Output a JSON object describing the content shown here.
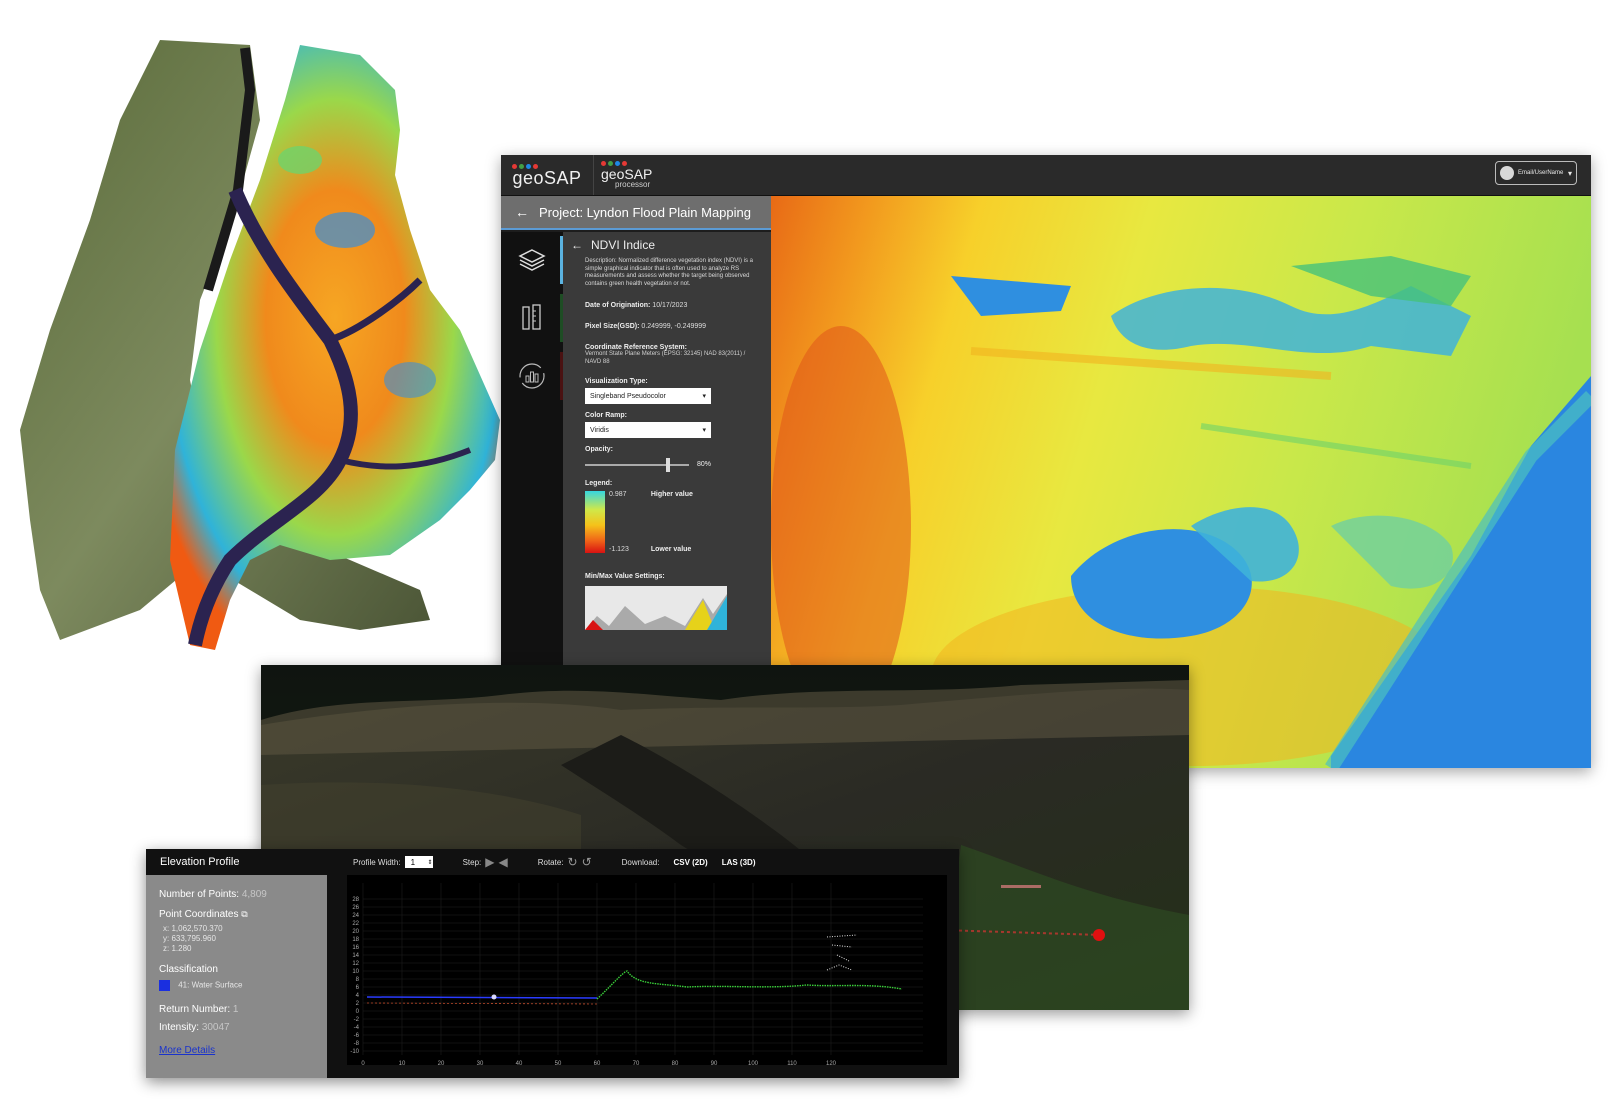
{
  "app": {
    "brand_primary": "geoSAP",
    "brand_secondary": "geoSAP",
    "brand_secondary_sub": "processor",
    "user_label": "Email/UserName",
    "project_title": "Project: Lyndon Flood Plain Mapping",
    "icons": [
      "layers-icon",
      "measure-ruler-icon",
      "analytics-refresh-icon"
    ],
    "panel": {
      "title": "NDVI Indice",
      "description": "Description: Normalized difference vegetation index (NDVI) is a simple graphical indicator that is often used to analyze RS measurements and assess whether the target being observed contains green health vegetation or not.",
      "date_label": "Date of Origination:",
      "date_value": "10/17/2023",
      "pixel_label": "Pixel Size(GSD):",
      "pixel_value": "0.249999, -0.249999",
      "crs_label": "Coordinate Reference System:",
      "crs_value": "Vermont State Plane Meters (EPSG: 32145) NAD 83(2011) / NAVD 88",
      "vis_label": "Visualization Type:",
      "vis_value": "Singleband Pseudocolor",
      "ramp_label": "Color Ramp:",
      "ramp_value": "Viridis",
      "opacity_label": "Opacity:",
      "opacity_value": "80%",
      "opacity_fraction": 0.8,
      "legend_label": "Legend:",
      "legend_max": "0.987",
      "legend_min": "-1.123",
      "legend_high": "Higher value",
      "legend_low": "Lower value",
      "minmax_label": "Min/Max Value Settings:"
    }
  },
  "elevation": {
    "title": "Elevation Profile",
    "points_label": "Number of Points:",
    "points_value": "4,809",
    "coords_label": "Point Coordinates",
    "x": "x: 1,062,570.370",
    "y": "y: 633,795.960",
    "z": "z: 1.280",
    "class_label": "Classification",
    "class_value": "41: Water Surface",
    "class_color": "#1a2fe0",
    "return_label": "Return Number:",
    "return_value": "1",
    "intensity_label": "Intensity:",
    "intensity_value": "30047",
    "more_details": "More Details",
    "profile_width_label": "Profile Width:",
    "profile_width_value": "1",
    "step_label": "Step:",
    "rotate_label": "Rotate:",
    "download_label": "Download:",
    "csv_label": "CSV (2D)",
    "las_label": "LAS (3D)",
    "x_ticks": [
      "0",
      "10",
      "20",
      "30",
      "40",
      "50",
      "60",
      "70",
      "80",
      "90",
      "100",
      "110",
      "120"
    ],
    "y_ticks": [
      "28",
      "26",
      "24",
      "22",
      "20",
      "18",
      "16",
      "14",
      "12",
      "10",
      "8",
      "6",
      "4",
      "2",
      "0",
      "-2",
      "-4",
      "-6",
      "-8",
      "-10"
    ]
  }
}
